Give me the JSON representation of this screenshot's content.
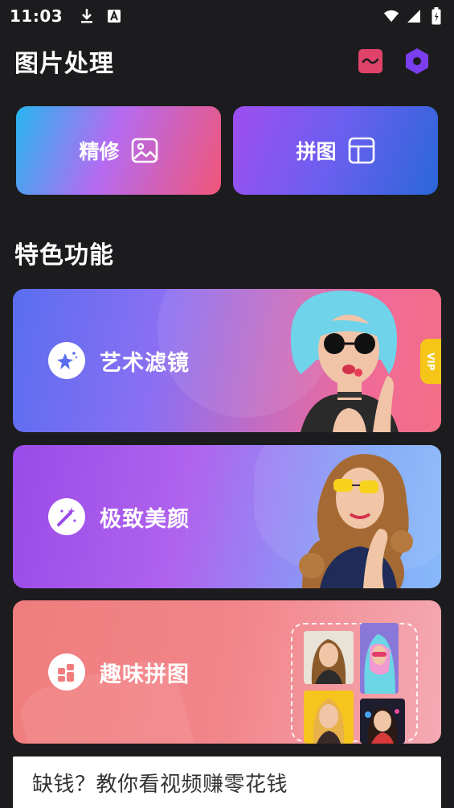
{
  "status_bar": {
    "time": "11:03",
    "left_icons": [
      "download-icon",
      "font-icon"
    ],
    "right_icons": [
      "wifi-icon",
      "signal-icon",
      "battery-icon"
    ]
  },
  "header": {
    "title": "图片处理",
    "actions": [
      "mask-icon",
      "hexagon-settings-icon"
    ]
  },
  "quick_actions": [
    {
      "label": "精修",
      "icon": "image-icon"
    },
    {
      "label": "拼图",
      "icon": "layout-icon"
    }
  ],
  "features": {
    "title": "特色功能",
    "cards": [
      {
        "label": "艺术滤镜",
        "icon": "magic-star-icon",
        "badge": "VIP"
      },
      {
        "label": "极致美颜",
        "icon": "magic-wand-icon"
      },
      {
        "label": "趣味拼图",
        "icon": "grid-blocks-icon"
      }
    ]
  },
  "ad": {
    "text": "缺钱？教你看视频赚零花钱"
  },
  "colors": {
    "background": "#1c1c1e",
    "retouch_gradient": [
      "#27b6ee",
      "#f05678"
    ],
    "collage_gradient": [
      "#9f4ef0",
      "#2a67d8"
    ],
    "header_mask_icon": "#e0436a",
    "header_hex_icon": "#7b3ff0",
    "vip": "#f5c518"
  }
}
